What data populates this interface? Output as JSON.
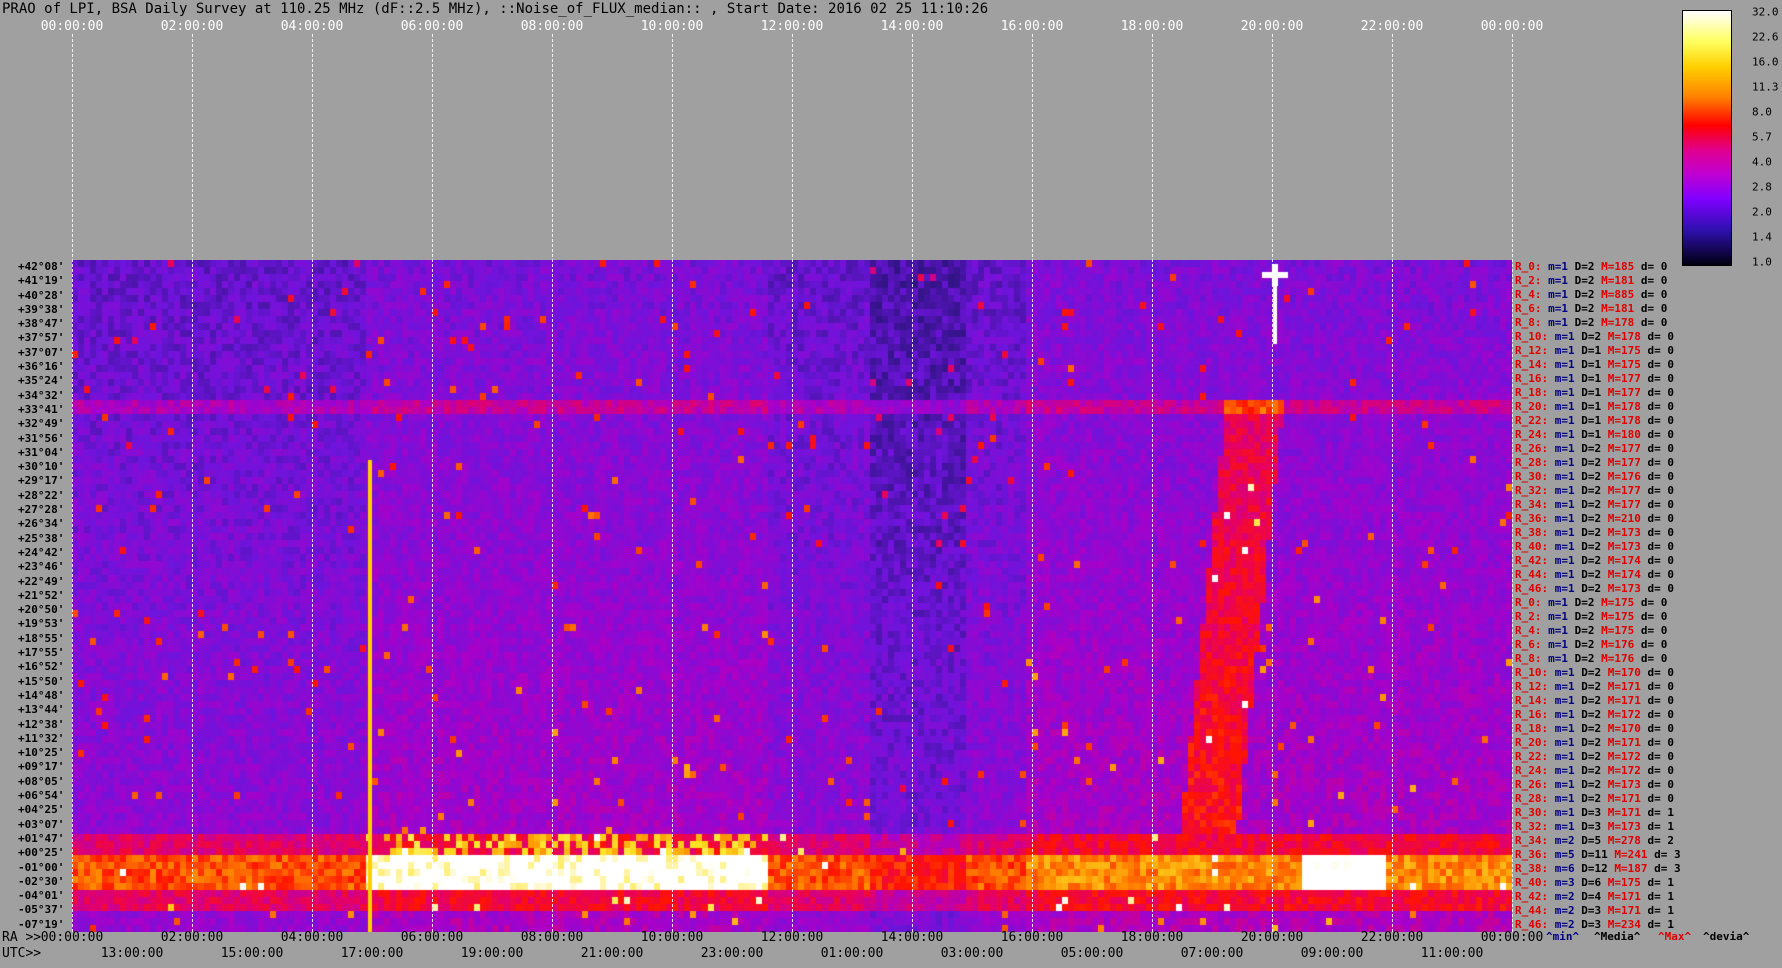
{
  "title": "PRAO of LPI, BSA Daily Survey at 110.25 MHz (dF::2.5 MHz), ::Noise_of_FLUX_median:: , Start Date: 2016 02 25 11:10:26",
  "top_ticks": [
    "00:00:00",
    "02:00:00",
    "04:00:00",
    "06:00:00",
    "08:00:00",
    "10:00:00",
    "12:00:00",
    "14:00:00",
    "16:00:00",
    "18:00:00",
    "20:00:00",
    "22:00:00",
    "00:00:00"
  ],
  "ra_prefix": "RA >>",
  "ra_ticks": [
    "00:00:00",
    "02:00:00",
    "04:00:00",
    "06:00:00",
    "08:00:00",
    "10:00:00",
    "12:00:00",
    "14:00:00",
    "16:00:00",
    "18:00:00",
    "20:00:00",
    "22:00:00",
    "00:00:00"
  ],
  "utc_prefix": "UTC>>",
  "utc_ticks": [
    "13:00:00",
    "15:00:00",
    "17:00:00",
    "19:00:00",
    "21:00:00",
    "23:00:00",
    "01:00:00",
    "03:00:00",
    "05:00:00",
    "07:00:00",
    "09:00:00",
    "11:00:00"
  ],
  "declinations": [
    "+42°08'",
    "+41°19'",
    "+40°28'",
    "+39°38'",
    "+38°47'",
    "+37°57'",
    "+37°07'",
    "+36°16'",
    "+35°24'",
    "+34°32'",
    "+33°41'",
    "+32°49'",
    "+31°56'",
    "+31°04'",
    "+30°10'",
    "+29°17'",
    "+28°22'",
    "+27°28'",
    "+26°34'",
    "+25°38'",
    "+24°42'",
    "+23°46'",
    "+22°49'",
    "+21°52'",
    "+20°50'",
    "+19°53'",
    "+18°55'",
    "+17°55'",
    "+16°52'",
    "+15°50'",
    "+14°48'",
    "+13°44'",
    "+12°38'",
    "+11°32'",
    "+10°25'",
    "+09°17'",
    "+08°05'",
    "+06°54'",
    "+04°25'",
    "+03°07'",
    "+01°47'",
    "+00°25'",
    "-01°00'",
    "-02°30'",
    "-04°01'",
    "-05°37'",
    "-07°19'"
  ],
  "row_stats": [
    {
      "r": "R_0:",
      "m": "m=1",
      "D": "D=2",
      "M": "M=185",
      "d": "d= 0"
    },
    {
      "r": "R_2:",
      "m": "m=1",
      "D": "D=2",
      "M": "M=181",
      "d": "d= 0"
    },
    {
      "r": "R_4:",
      "m": "m=1",
      "D": "D=2",
      "M": "M=885",
      "d": "d= 0"
    },
    {
      "r": "R_6:",
      "m": "m=1",
      "D": "D=2",
      "M": "M=181",
      "d": "d= 0"
    },
    {
      "r": "R_8:",
      "m": "m=1",
      "D": "D=2",
      "M": "M=178",
      "d": "d= 0"
    },
    {
      "r": "R_10:",
      "m": "m=1",
      "D": "D=2",
      "M": "M=178",
      "d": "d= 0"
    },
    {
      "r": "R_12:",
      "m": "m=1",
      "D": "D=1",
      "M": "M=175",
      "d": "d= 0"
    },
    {
      "r": "R_14:",
      "m": "m=1",
      "D": "D=1",
      "M": "M=175",
      "d": "d= 0"
    },
    {
      "r": "R_16:",
      "m": "m=1",
      "D": "D=1",
      "M": "M=177",
      "d": "d= 0"
    },
    {
      "r": "R_18:",
      "m": "m=1",
      "D": "D=1",
      "M": "M=177",
      "d": "d= 0"
    },
    {
      "r": "R_20:",
      "m": "m=1",
      "D": "D=1",
      "M": "M=178",
      "d": "d= 0"
    },
    {
      "r": "R_22:",
      "m": "m=1",
      "D": "D=1",
      "M": "M=178",
      "d": "d= 0"
    },
    {
      "r": "R_24:",
      "m": "m=1",
      "D": "D=1",
      "M": "M=180",
      "d": "d= 0"
    },
    {
      "r": "R_26:",
      "m": "m=1",
      "D": "D=2",
      "M": "M=177",
      "d": "d= 0"
    },
    {
      "r": "R_28:",
      "m": "m=1",
      "D": "D=2",
      "M": "M=177",
      "d": "d= 0"
    },
    {
      "r": "R_30:",
      "m": "m=1",
      "D": "D=2",
      "M": "M=176",
      "d": "d= 0"
    },
    {
      "r": "R_32:",
      "m": "m=1",
      "D": "D=2",
      "M": "M=177",
      "d": "d= 0"
    },
    {
      "r": "R_34:",
      "m": "m=1",
      "D": "D=2",
      "M": "M=177",
      "d": "d= 0"
    },
    {
      "r": "R_36:",
      "m": "m=1",
      "D": "D=2",
      "M": "M=210",
      "d": "d= 0"
    },
    {
      "r": "R_38:",
      "m": "m=1",
      "D": "D=2",
      "M": "M=173",
      "d": "d= 0"
    },
    {
      "r": "R_40:",
      "m": "m=1",
      "D": "D=2",
      "M": "M=173",
      "d": "d= 0"
    },
    {
      "r": "R_42:",
      "m": "m=1",
      "D": "D=2",
      "M": "M=174",
      "d": "d= 0"
    },
    {
      "r": "R_44:",
      "m": "m=1",
      "D": "D=2",
      "M": "M=174",
      "d": "d= 0"
    },
    {
      "r": "R_46:",
      "m": "m=1",
      "D": "D=2",
      "M": "M=173",
      "d": "d= 0"
    },
    {
      "r": "R_0:",
      "m": "m=1",
      "D": "D=2",
      "M": "M=175",
      "d": "d= 0"
    },
    {
      "r": "R_2:",
      "m": "m=1",
      "D": "D=2",
      "M": "M=175",
      "d": "d= 0"
    },
    {
      "r": "R_4:",
      "m": "m=1",
      "D": "D=2",
      "M": "M=175",
      "d": "d= 0"
    },
    {
      "r": "R_6:",
      "m": "m=1",
      "D": "D=2",
      "M": "M=176",
      "d": "d= 0"
    },
    {
      "r": "R_8:",
      "m": "m=1",
      "D": "D=2",
      "M": "M=176",
      "d": "d= 0"
    },
    {
      "r": "R_10:",
      "m": "m=1",
      "D": "D=2",
      "M": "M=170",
      "d": "d= 0"
    },
    {
      "r": "R_12:",
      "m": "m=1",
      "D": "D=2",
      "M": "M=171",
      "d": "d= 0"
    },
    {
      "r": "R_14:",
      "m": "m=1",
      "D": "D=2",
      "M": "M=171",
      "d": "d= 0"
    },
    {
      "r": "R_16:",
      "m": "m=1",
      "D": "D=2",
      "M": "M=172",
      "d": "d= 0"
    },
    {
      "r": "R_18:",
      "m": "m=1",
      "D": "D=2",
      "M": "M=170",
      "d": "d= 0"
    },
    {
      "r": "R_20:",
      "m": "m=1",
      "D": "D=2",
      "M": "M=171",
      "d": "d= 0"
    },
    {
      "r": "R_22:",
      "m": "m=1",
      "D": "D=2",
      "M": "M=172",
      "d": "d= 0"
    },
    {
      "r": "R_24:",
      "m": "m=1",
      "D": "D=2",
      "M": "M=172",
      "d": "d= 0"
    },
    {
      "r": "R_26:",
      "m": "m=1",
      "D": "D=2",
      "M": "M=173",
      "d": "d= 0"
    },
    {
      "r": "R_28:",
      "m": "m=1",
      "D": "D=2",
      "M": "M=171",
      "d": "d= 0"
    },
    {
      "r": "R_30:",
      "m": "m=1",
      "D": "D=3",
      "M": "M=171",
      "d": "d= 1"
    },
    {
      "r": "R_32:",
      "m": "m=1",
      "D": "D=3",
      "M": "M=173",
      "d": "d= 1"
    },
    {
      "r": "R_34:",
      "m": "m=2",
      "D": "D=5",
      "M": "M=278",
      "d": "d= 2"
    },
    {
      "r": "R_36:",
      "m": "m=5",
      "D": "D=11",
      "M": "M=241",
      "d": "d= 3"
    },
    {
      "r": "R_38:",
      "m": "m=6",
      "D": "D=12",
      "M": "M=187",
      "d": "d= 3"
    },
    {
      "r": "R_40:",
      "m": "m=3",
      "D": "D=6",
      "M": "M=175",
      "d": "d= 1"
    },
    {
      "r": "R_42:",
      "m": "m=2",
      "D": "D=4",
      "M": "M=171",
      "d": "d= 1"
    },
    {
      "r": "R_44:",
      "m": "m=2",
      "D": "D=3",
      "M": "M=171",
      "d": "d= 1"
    },
    {
      "r": "R_46:",
      "m": "m=2",
      "D": "D=3",
      "M": "M=234",
      "d": "d= 1"
    }
  ],
  "colorbar_labels": [
    "32.0",
    "22.6",
    "16.0",
    "11.3",
    "8.0",
    "5.7",
    "4.0",
    "2.8",
    "2.0",
    "1.4",
    "1.0"
  ],
  "legend": {
    "min": "^min^",
    "median": "^Media^",
    "max": "^Max^",
    "dev": "^devia^"
  }
}
